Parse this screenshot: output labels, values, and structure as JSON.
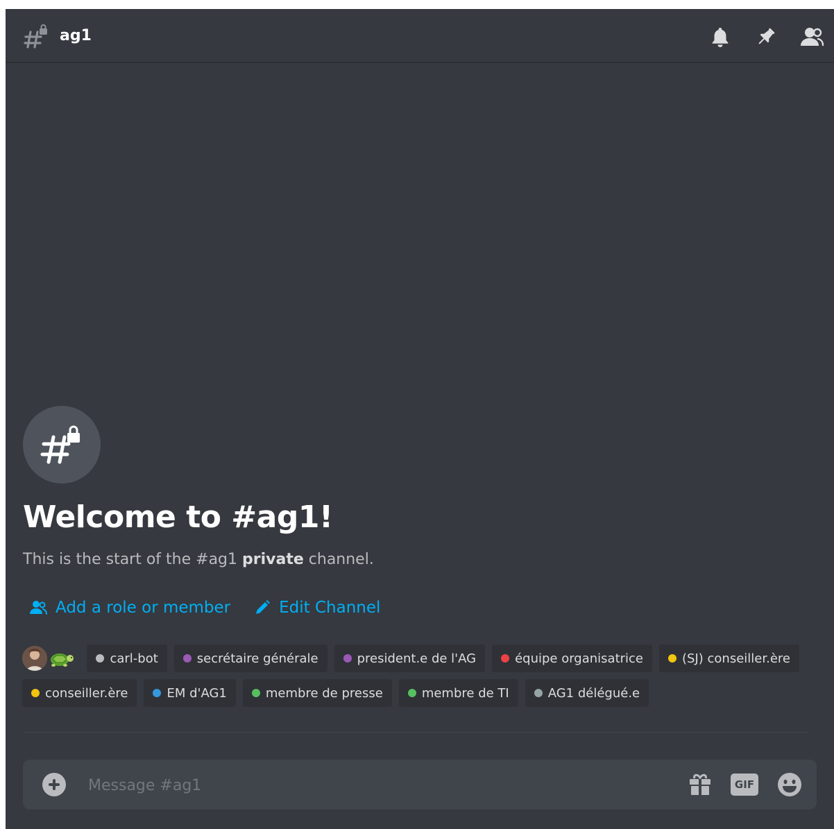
{
  "header": {
    "channel_name": "ag1",
    "icons": [
      "locked-channel-icon",
      "bell-icon",
      "pin-icon",
      "members-icon"
    ]
  },
  "welcome": {
    "title": "Welcome to #ag1!",
    "subtitle_prefix": "This is the start of the #ag1 ",
    "subtitle_bold": "private",
    "subtitle_suffix": " channel."
  },
  "actions": {
    "add_role_label": "Add a role or member",
    "edit_channel_label": "Edit Channel"
  },
  "roles_row1": [
    {
      "label": "carl-bot",
      "color": "#b9bbbe"
    },
    {
      "label": "secrétaire générale",
      "color": "#9b59b6"
    },
    {
      "label": "president.e de l'AG",
      "color": "#9b59b6"
    },
    {
      "label": "équipe organisatrice",
      "color": "#ed4245"
    },
    {
      "label": "(SJ) conseiller.ère",
      "color": "#f1c40f"
    }
  ],
  "roles_row2": [
    {
      "label": "conseiller.ère",
      "color": "#f1c40f"
    },
    {
      "label": "EM d'AG1",
      "color": "#3498db"
    },
    {
      "label": "membre de presse",
      "color": "#57c05f"
    },
    {
      "label": "membre de TI",
      "color": "#57c05f"
    },
    {
      "label": "AG1 délégué.e",
      "color": "#95a5a6"
    }
  ],
  "composer": {
    "placeholder": "Message #ag1",
    "gif_label": "GIF"
  },
  "colors": {
    "background": "#36393f",
    "link": "#00aff4",
    "pill": "#2f3136"
  }
}
